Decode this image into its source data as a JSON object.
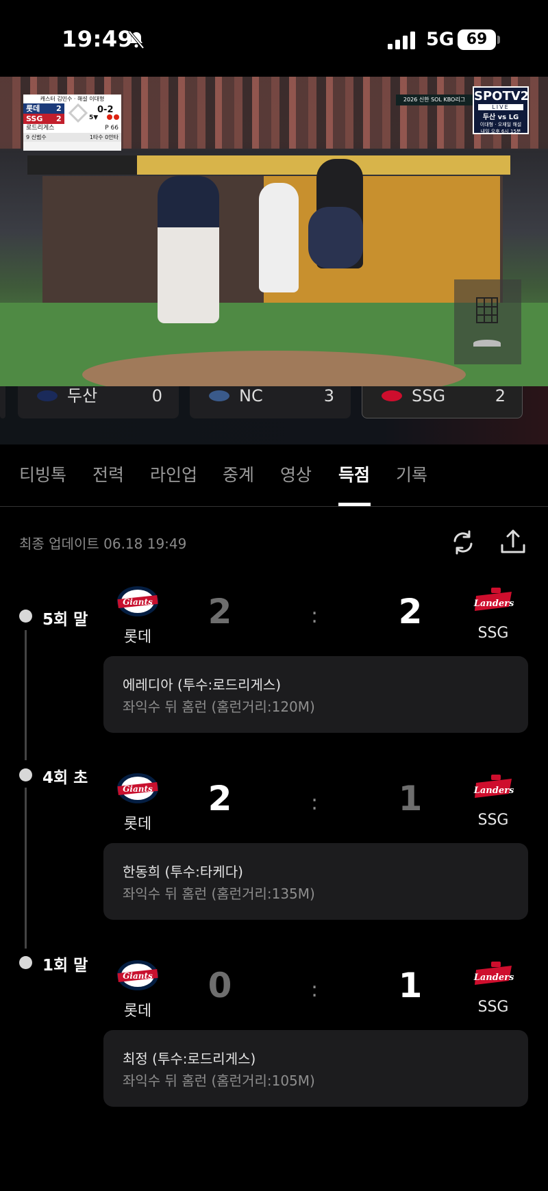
{
  "status_bar": {
    "time": "19:49",
    "network": "5G",
    "battery": "69"
  },
  "broadcast": {
    "commentators": "캐스터 김민수 · 해설 이대형",
    "away_team": "롯데",
    "away_score": "2",
    "home_team": "SSG",
    "home_score": "2",
    "count": "0-2",
    "inning": "5▼",
    "pitcher": "로드리게스",
    "pitch_count": "P 66",
    "batter_info": "9 신범수",
    "batter_record": "1타수 0안타",
    "league": "2026 신한 SOL KBO리그",
    "channel": "SPOTV2",
    "live": "LIVE",
    "next_game": "두산 vs LG",
    "next_commentators": "이대형 · 오재일 해설",
    "next_time": "내일 오후 6시 15분"
  },
  "team_strip": [
    {
      "name": "두산",
      "score": "0"
    },
    {
      "name": "NC",
      "score": "3"
    },
    {
      "name": "SSG",
      "score": "2"
    }
  ],
  "tabs": [
    "티빙톡",
    "전력",
    "라인업",
    "중계",
    "영상",
    "득점",
    "기록"
  ],
  "active_tab": "득점",
  "update": {
    "label": "최종 업데이트 06.18 19:49"
  },
  "scoring_events": [
    {
      "inning": "5회 말",
      "away_team": "롯데",
      "away_score": "2",
      "home_team": "SSG",
      "home_score": "2",
      "separator": ":",
      "title": "에레디아 (투수:로드리게스)",
      "desc": "좌익수 뒤 홈런 (홈런거리:120M)"
    },
    {
      "inning": "4회 초",
      "away_team": "롯데",
      "away_score": "2",
      "home_team": "SSG",
      "home_score": "1",
      "separator": ":",
      "title": "한동희 (투수:타케다)",
      "desc": "좌익수 뒤 홈런 (홈런거리:135M)"
    },
    {
      "inning": "1회 말",
      "away_team": "롯데",
      "away_score": "0",
      "home_team": "SSG",
      "home_score": "1",
      "separator": ":",
      "title": "최정 (투수:로드리게스)",
      "desc": "좌익수 뒤 홈런 (홈런거리:105M)"
    }
  ],
  "colors": {
    "accent_active": "#ffffff",
    "card_bg": "#1c1c1e",
    "giants_red": "#c8102e",
    "landers_red": "#ce0e2d",
    "giants_navy": "#041e42"
  }
}
